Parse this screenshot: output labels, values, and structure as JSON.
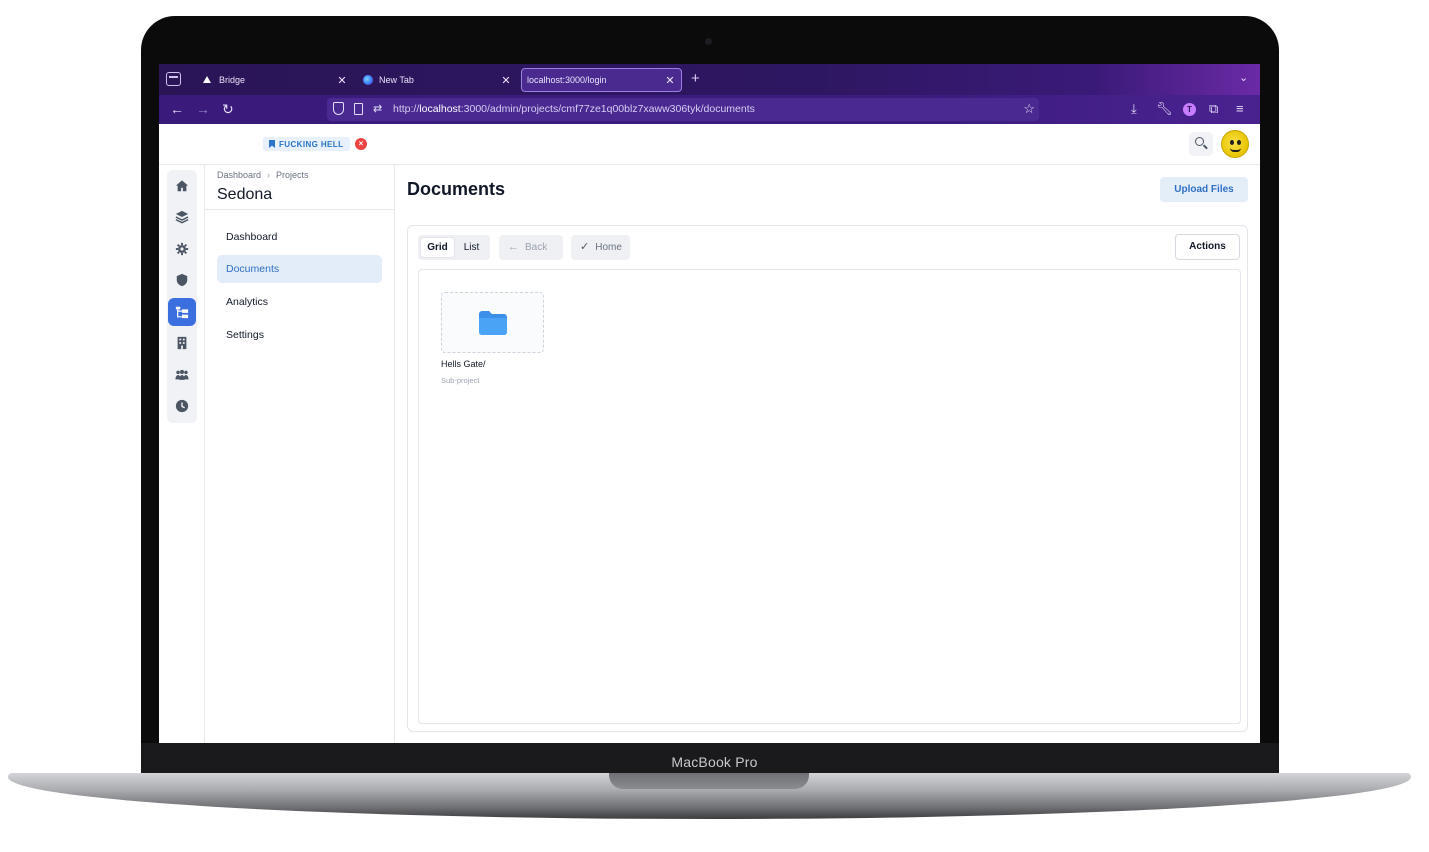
{
  "device": {
    "label": "MacBook Pro"
  },
  "browser": {
    "tabs": [
      {
        "title": "Bridge",
        "favicon": "triangle-icon",
        "active": false
      },
      {
        "title": "New Tab",
        "favicon": "firefox-icon",
        "active": false
      },
      {
        "title": "localhost:3000/login",
        "favicon": "",
        "active": true
      }
    ],
    "url": {
      "prefix": "http://",
      "host": "localhost",
      "rest": ":3000/admin/projects/cmf77ze1q00blz7xaww306tyk/documents"
    },
    "profile_initial": "T",
    "accent": "#2e1762"
  },
  "header": {
    "env_badge": "FUCKING HELL",
    "env_close": "×"
  },
  "rail": {
    "items": [
      {
        "icon": "home-icon",
        "active": false
      },
      {
        "icon": "layers-icon",
        "active": false
      },
      {
        "icon": "gear-icon",
        "active": false
      },
      {
        "icon": "shield-icon",
        "active": false
      },
      {
        "icon": "folder-tree-icon",
        "active": true
      },
      {
        "icon": "building-icon",
        "active": false
      },
      {
        "icon": "users-icon",
        "active": false
      },
      {
        "icon": "clock-icon",
        "active": false
      }
    ],
    "active_color": "#3b6fe0"
  },
  "project_sidebar": {
    "breadcrumb": [
      "Dashboard",
      "Projects"
    ],
    "breadcrumb_sep": "›",
    "title": "Sedona",
    "items": [
      {
        "label": "Dashboard",
        "active": false
      },
      {
        "label": "Documents",
        "active": true
      },
      {
        "label": "Analytics",
        "active": false
      },
      {
        "label": "Settings",
        "active": false
      }
    ]
  },
  "main": {
    "title": "Documents",
    "upload_label": "Upload Files",
    "view_toggle": {
      "grid": "Grid",
      "list": "List",
      "selected": "Grid"
    },
    "back_label": "Back",
    "home_label": "Home",
    "actions_label": "Actions",
    "items": [
      {
        "name": "Hells Gate/",
        "type": "Sub-project",
        "icon": "folder-icon"
      }
    ]
  }
}
